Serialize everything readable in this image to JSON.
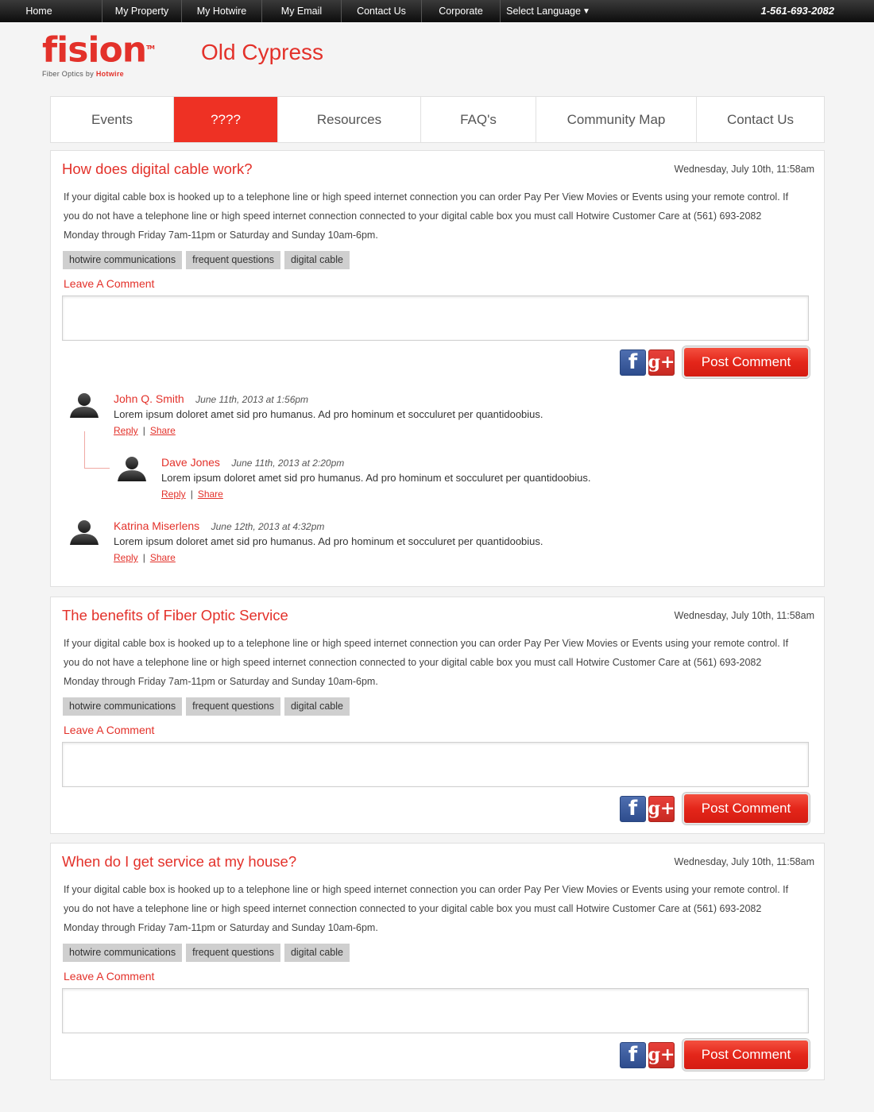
{
  "topnav": {
    "items": [
      "Home",
      "My Property",
      "My Hotwire",
      "My Email",
      "Contact Us",
      "Corporate",
      "Select Language"
    ],
    "phone": "1-561-693-2082"
  },
  "header": {
    "logo_text": "fision",
    "logo_tm": "TM",
    "logo_sub_prefix": "Fiber Optics by ",
    "logo_sub_brand": "Hotwire",
    "site_title": "Old Cypress"
  },
  "mainnav": {
    "items": [
      "Events",
      "????",
      "Resources",
      "FAQ's",
      "Community Map",
      "Contact Us"
    ],
    "active_index": 1
  },
  "posts": [
    {
      "title": "How does digital cable work?",
      "date": "Wednesday, July 10th, 11:58am",
      "body": "If your digital cable box is hooked up to a telephone line or high speed internet connection you can order Pay Per View Movies or Events using your remote control. If you do not have a telephone line or high speed internet connection connected to your digital cable box you must call Hotwire Customer Care at (561) 693-2082 Monday through Friday 7am-11pm or Saturday and Sunday 10am-6pm.",
      "tags": [
        "hotwire communications",
        "frequent questions",
        "digital cable"
      ],
      "leave_comment": "Leave A Comment",
      "post_button": "Post Comment",
      "comments": [
        {
          "author": "John Q. Smith",
          "date": "June 11th, 2013 at 1:56pm",
          "text": "Lorem ipsum doloret amet sid pro humanus.  Ad pro hominum et socculuret per quantidoobius.",
          "reply": "Reply",
          "share": "Share",
          "sep": "|"
        },
        {
          "author": "Dave Jones",
          "date": "June 11th, 2013 at 2:20pm",
          "text": "Lorem ipsum doloret amet sid pro humanus.  Ad pro hominum et socculuret per quantidoobius.",
          "reply": "Reply",
          "share": "Share",
          "sep": "|"
        },
        {
          "author": "Katrina Miserlens",
          "date": "June 12th, 2013 at 4:32pm",
          "text": "Lorem ipsum doloret amet sid pro humanus.  Ad pro hominum et socculuret per quantidoobius.",
          "reply": "Reply",
          "share": "Share",
          "sep": "|"
        }
      ]
    },
    {
      "title": "The benefits of Fiber Optic Service",
      "date": "Wednesday, July 10th, 11:58am",
      "body": "If your digital cable box is hooked up to a telephone line or high speed internet connection you can order Pay Per View Movies or Events using your remote control. If you do not have a telephone line or high speed internet connection connected to your digital cable box you must call Hotwire Customer Care at (561) 693-2082 Monday through Friday 7am-11pm or Saturday and Sunday 10am-6pm.",
      "tags": [
        "hotwire communications",
        "frequent questions",
        "digital cable"
      ],
      "leave_comment": "Leave A Comment",
      "post_button": "Post Comment"
    },
    {
      "title": "When do I get service at my house?",
      "date": "Wednesday, July 10th, 11:58am",
      "body": "If your digital cable box is hooked up to a telephone line or high speed internet connection you can order Pay Per View Movies or Events using your remote control. If you do not have a telephone line or high speed internet connection connected to your digital cable box you must call Hotwire Customer Care at (561) 693-2082 Monday through Friday 7am-11pm or Saturday and Sunday 10am-6pm.",
      "tags": [
        "hotwire communications",
        "frequent questions",
        "digital cable"
      ],
      "leave_comment": "Leave A Comment",
      "post_button": "Post Comment"
    }
  ],
  "social": {
    "facebook_glyph": "f",
    "gplus_glyph": "g+"
  },
  "colors": {
    "brand_red": "#e3312a",
    "nav_active": "#ee3124",
    "topbar": "#1a1a1a"
  }
}
